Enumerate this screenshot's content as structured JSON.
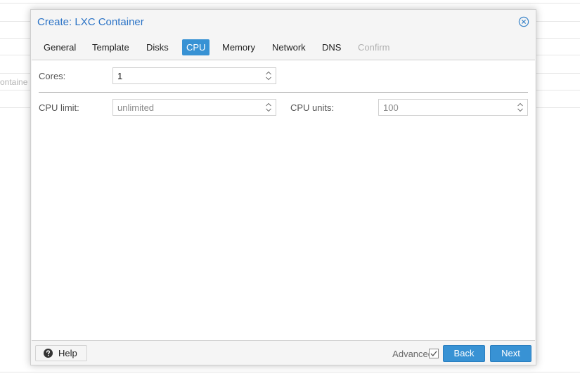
{
  "background": {
    "fragments": [
      "ontaine"
    ]
  },
  "window": {
    "title": "Create: LXC Container"
  },
  "tabs": [
    {
      "label": "General",
      "state": "normal"
    },
    {
      "label": "Template",
      "state": "normal"
    },
    {
      "label": "Disks",
      "state": "normal"
    },
    {
      "label": "CPU",
      "state": "active"
    },
    {
      "label": "Memory",
      "state": "normal"
    },
    {
      "label": "Network",
      "state": "normal"
    },
    {
      "label": "DNS",
      "state": "normal"
    },
    {
      "label": "Confirm",
      "state": "disabled"
    }
  ],
  "form": {
    "cores": {
      "label": "Cores:",
      "value": "1"
    },
    "cpu_limit": {
      "label": "CPU limit:",
      "placeholder": "unlimited"
    },
    "cpu_units": {
      "label": "CPU units:",
      "placeholder": "100"
    }
  },
  "footer": {
    "help_label": "Help",
    "advanced_label": "Advanced",
    "advanced_checked": true,
    "back_label": "Back",
    "next_label": "Next"
  },
  "colors": {
    "accent": "#3892d4",
    "title": "#2b73c6"
  },
  "icons": {
    "close": "close-circle-icon",
    "help": "question-circle-icon",
    "spinner": "spin-arrows-icon",
    "check": "checkbox-checked-icon"
  }
}
